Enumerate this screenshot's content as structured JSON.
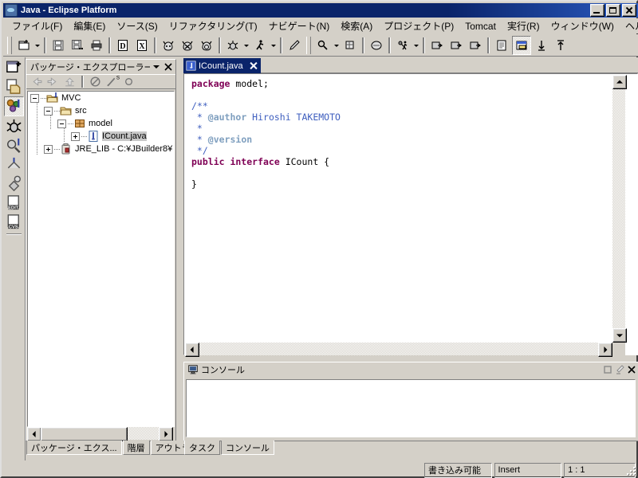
{
  "window": {
    "title": "Java - Eclipse Platform",
    "icon": "eclipse-icon",
    "buttons": {
      "minimize": "minimize",
      "maximize": "maximize",
      "close": "close"
    }
  },
  "menubar": {
    "items": [
      {
        "label": "ファイル(F)",
        "name": "menu-file"
      },
      {
        "label": "編集(E)",
        "name": "menu-edit"
      },
      {
        "label": "ソース(S)",
        "name": "menu-source"
      },
      {
        "label": "リファクタリング(T)",
        "name": "menu-refactor"
      },
      {
        "label": "ナビゲート(N)",
        "name": "menu-navigate"
      },
      {
        "label": "検索(A)",
        "name": "menu-search"
      },
      {
        "label": "プロジェクト(P)",
        "name": "menu-project"
      },
      {
        "label": "Tomcat",
        "name": "menu-tomcat"
      },
      {
        "label": "実行(R)",
        "name": "menu-run"
      },
      {
        "label": "ウィンドウ(W)",
        "name": "menu-window"
      },
      {
        "label": "ヘルプ(H)",
        "name": "menu-help"
      }
    ]
  },
  "toolbar": {
    "groups": [
      [
        "new-wizard-icon",
        "dropdown-arrow"
      ],
      [
        "save-icon",
        "save-all-icon",
        "print-icon"
      ],
      [
        "javadoc-icon",
        "export-icon"
      ],
      [
        "tomcat-start-icon",
        "tomcat-stop-icon",
        "tomcat-restart-icon"
      ],
      [
        "debug-icon",
        "dropdown-arrow",
        "run-icon",
        "dropdown-arrow"
      ],
      [
        "external-tools-icon"
      ],
      [
        "search-icon",
        "dropdown-arrow",
        "open-type-icon"
      ],
      [
        "cvs-icon"
      ],
      [
        "run-ant-icon",
        "dropdown-arrow"
      ],
      [
        "next-annotation-icon",
        "previous-annotation-icon",
        "last-edit-icon"
      ],
      [
        "outline-icon",
        "editor-area-icon",
        "back-icon",
        "forward-icon"
      ]
    ]
  },
  "perspective_bar": {
    "items": [
      {
        "name": "new-perspective-icon",
        "selected": false
      },
      {
        "name": "resource-perspective-icon",
        "selected": false
      },
      {
        "name": "java-perspective-icon",
        "selected": true
      },
      {
        "name": "debug-perspective-icon",
        "selected": false
      },
      {
        "name": "java-browsing-perspective-icon",
        "selected": false
      },
      {
        "name": "java-type-hierarchy-icon",
        "selected": false
      },
      {
        "name": "plugin-development-icon",
        "selected": false
      },
      {
        "name": "edit-perspective-icon",
        "selected": false
      },
      {
        "name": "cvs-repository-icon",
        "selected": false
      }
    ]
  },
  "package_explorer": {
    "title": "パッケージ・エクスプローラー",
    "menu_button": "view-menu-icon",
    "close_button": "close-icon",
    "toolbar": [
      {
        "name": "back-icon",
        "enabled": false
      },
      {
        "name": "forward-icon",
        "enabled": false
      },
      {
        "name": "up-icon",
        "enabled": false
      },
      {
        "name": "collapse-all-icon",
        "enabled": true
      },
      {
        "name": "link-with-editor-icon",
        "enabled": true
      },
      {
        "name": "filter-icon",
        "enabled": true
      }
    ],
    "tree": [
      {
        "label": "MVC",
        "indent": 0,
        "expander": "minus",
        "icon": "java-project-icon",
        "selected": false
      },
      {
        "label": "src",
        "indent": 1,
        "expander": "minus",
        "icon": "source-folder-icon",
        "selected": false
      },
      {
        "label": "model",
        "indent": 2,
        "expander": "minus",
        "icon": "package-icon",
        "selected": false
      },
      {
        "label": "ICount.java",
        "indent": 3,
        "expander": "plus",
        "icon": "java-interface-file-icon",
        "selected": true
      },
      {
        "label": "JRE_LIB - C:¥JBuilder8¥",
        "indent": 1,
        "expander": "plus",
        "icon": "jar-library-icon",
        "selected": false
      }
    ]
  },
  "editor": {
    "tabs": [
      {
        "label": "ICount.java",
        "icon": "java-file-icon",
        "active": true,
        "close": "close-icon"
      }
    ],
    "code_lines": [
      [
        {
          "t": "package ",
          "c": "kw"
        },
        {
          "t": "model;",
          "c": "plain"
        }
      ],
      [
        {
          "t": "",
          "c": "plain"
        }
      ],
      [
        {
          "t": "/**",
          "c": "jd"
        }
      ],
      [
        {
          "t": " * ",
          "c": "jd"
        },
        {
          "t": "@author",
          "c": "jdt"
        },
        {
          "t": " Hiroshi TAKEMOTO",
          "c": "jd"
        }
      ],
      [
        {
          "t": " *",
          "c": "jd"
        }
      ],
      [
        {
          "t": " * ",
          "c": "jd"
        },
        {
          "t": "@version",
          "c": "jdt"
        }
      ],
      [
        {
          "t": " */",
          "c": "jd"
        }
      ],
      [
        {
          "t": "public interface ",
          "c": "kw"
        },
        {
          "t": "ICount {",
          "c": "plain"
        }
      ],
      [
        {
          "t": "",
          "c": "plain"
        }
      ],
      [
        {
          "t": "}",
          "c": "plain"
        }
      ]
    ]
  },
  "console": {
    "title": "コンソール",
    "icon": "console-icon",
    "buttons": [
      {
        "name": "maximize-icon"
      },
      {
        "name": "clear-console-icon"
      },
      {
        "name": "close-icon"
      }
    ],
    "content": ""
  },
  "left_view_tabs": [
    {
      "label": "パッケージ・エクス...",
      "active": true,
      "name": "tab-package-explorer"
    },
    {
      "label": "階層",
      "active": false,
      "name": "tab-hierarchy"
    },
    {
      "label": "アウトライン",
      "active": false,
      "name": "tab-outline"
    }
  ],
  "bottom_view_tabs": [
    {
      "label": "タスク",
      "active": false,
      "name": "tab-tasks"
    },
    {
      "label": "コンソール",
      "active": true,
      "name": "tab-console"
    }
  ],
  "statusbar": {
    "panes": [
      {
        "label": "書き込み可能",
        "name": "status-writable"
      },
      {
        "label": "Insert",
        "name": "status-insert-mode"
      },
      {
        "label": "1 : 1",
        "name": "status-cursor-position"
      }
    ]
  },
  "colors": {
    "title_blue": "#0a246a",
    "face": "#d4d0c8",
    "keyword": "#7f0055",
    "javadoc": "#3f5fbf",
    "javadoc_tag": "#7f9fbf",
    "highlight_line": "#e8f0e0",
    "selection_gray": "#c8c8c8"
  }
}
